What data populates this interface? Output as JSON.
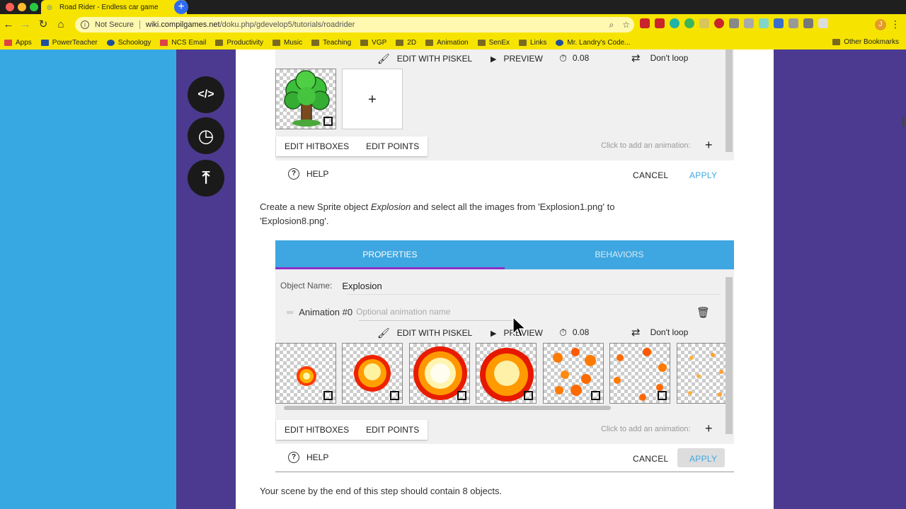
{
  "browser": {
    "tab_title": "Road Rider - Endless car game",
    "tab_close": "✕",
    "new_tab": "+",
    "not_secure": "Not Secure",
    "url_host": "wiki.compilgames.net",
    "url_path": "/doku.php/gdevelop5/tutorials/roadrider",
    "avatar_letter": "J",
    "bookmarks": [
      "Apps",
      "PowerTeacher",
      "Schoology",
      "NCS Email",
      "Productivity",
      "Music",
      "Teaching",
      "VGP",
      "2D",
      "Animation",
      "SenEx",
      "Links",
      "Mr. Landry's Code..."
    ],
    "other_bookmarks": "Other Bookmarks"
  },
  "fabs": {
    "code": "</>",
    "history": "◷",
    "top": "⤒"
  },
  "panel1": {
    "edit_with_piskel": "EDIT WITH PISKEL",
    "preview": "PREVIEW",
    "timer_value": "0.08",
    "loop_label": "Don't loop",
    "add_frame": "+",
    "edit_hitboxes": "EDIT HITBOXES",
    "edit_points": "EDIT POINTS",
    "add_animation_hint": "Click to add an animation:",
    "add_animation": "+",
    "help": "HELP",
    "cancel": "CANCEL",
    "apply": "APPLY"
  },
  "instruction": {
    "before": "Create a new Sprite object ",
    "object_name": "Explosion",
    "after": " and select all the images from 'Explosion1.png' to",
    "line2": "'Explosion8.png'."
  },
  "panel2": {
    "tab_properties": "PROPERTIES",
    "tab_behaviors": "BEHAVIORS",
    "object_name_label": "Object Name:",
    "object_name_value": "Explosion",
    "animation_label": "Animation #0",
    "animation_placeholder": "Optional animation name",
    "edit_with_piskel": "EDIT WITH PISKEL",
    "preview": "PREVIEW",
    "timer_value": "0.08",
    "loop_label": "Don't loop",
    "edit_hitboxes": "EDIT HITBOXES",
    "edit_points": "EDIT POINTS",
    "add_animation_hint": "Click to add an animation:",
    "add_animation": "+",
    "help": "HELP",
    "cancel": "CANCEL",
    "apply": "APPLY"
  },
  "footer_text": "Your scene by the end of this step should contain 8 objects.",
  "colors": {
    "chrome_yellow": "#f6e400",
    "page_blue": "#38a8e2",
    "page_purple": "#4b3a8f",
    "accent_blue": "#3ea6e0",
    "tab_underline": "#8e2ec8"
  }
}
